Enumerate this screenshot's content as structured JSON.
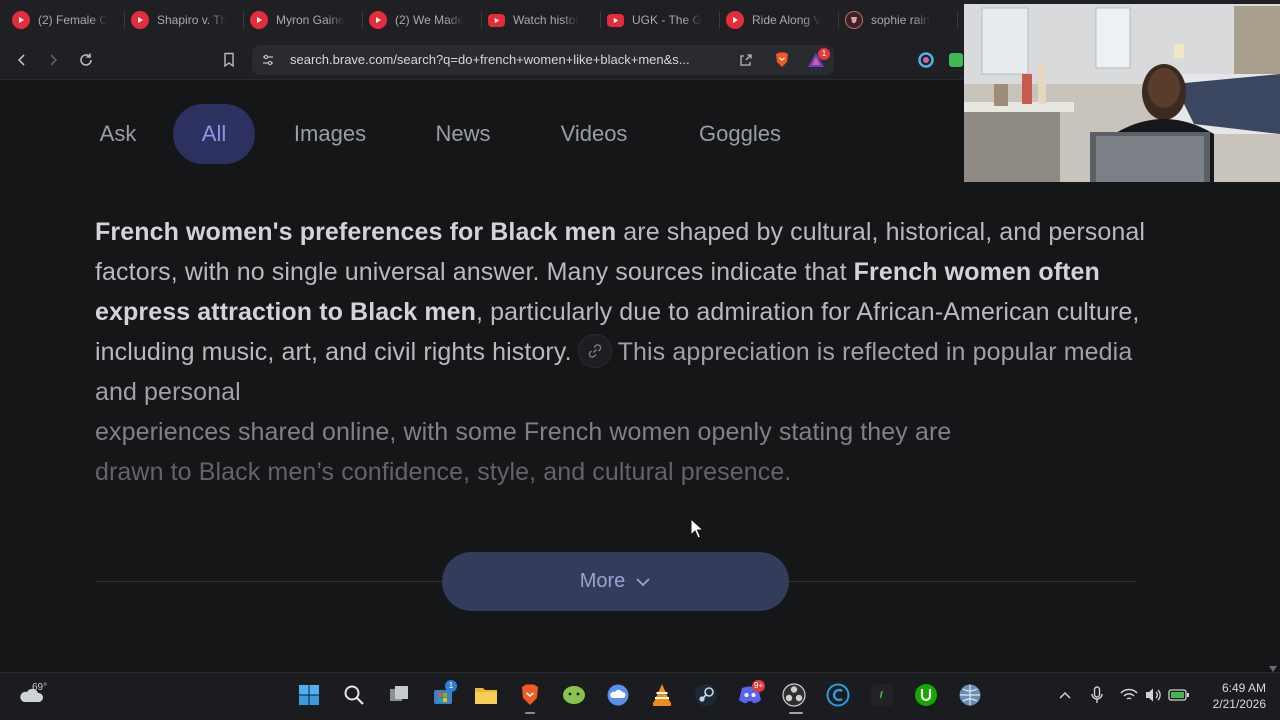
{
  "browser": {
    "tabs": [
      {
        "title": "(2) Female C",
        "icon": "youtube-circle-icon"
      },
      {
        "title": "Shapiro v. Th",
        "icon": "youtube-circle-icon"
      },
      {
        "title": "Myron Gaine",
        "icon": "youtube-circle-icon"
      },
      {
        "title": "(2) We Made",
        "icon": "youtube-circle-icon"
      },
      {
        "title": "Watch histor",
        "icon": "youtube-icon"
      },
      {
        "title": "UGK - The G",
        "icon": "youtube-icon"
      },
      {
        "title": "Ride Along V",
        "icon": "youtube-circle-icon"
      },
      {
        "title": "sophie rain",
        "icon": "brave-icon"
      }
    ],
    "url": "search.brave.com/search?q=do+french+women+like+black+men&s...",
    "rewards_badge": "1"
  },
  "search_nav": {
    "items": [
      "Ask",
      "All",
      "Images",
      "News",
      "Videos",
      "Goggles"
    ],
    "active": "All"
  },
  "answer": {
    "p1_bold": "French women's preferences for Black men",
    "p1_rest": " are shaped by cultural, historical, and personal factors, with no single universal answer. Many sources indicate that ",
    "p2_bold": "French women often express attraction to Black men",
    "p2_rest": ", particularly due to admiration for African-American culture, including music, art, and civil rights history.",
    "p3": "This appreciation is reflected in popular media and personal",
    "p4": "experiences shared online, with some French women openly stating they are",
    "p5": "drawn to Black men’s confidence, style, and cultural presence."
  },
  "more_button": {
    "label": "More"
  },
  "taskbar": {
    "weather": {
      "temp": "69°"
    },
    "apps": [
      "windows-start-icon",
      "search-icon",
      "task-view-icon",
      "microsoft-store-icon",
      "file-explorer-icon",
      "brave-icon",
      "android-icon",
      "cloud-app-icon",
      "vlc-icon",
      "steam-icon",
      "discord-icon",
      "obs-icon",
      "ccleaner-icon",
      "terminal-icon",
      "upwork-icon",
      "browser-globe-icon"
    ],
    "store_badge": "1",
    "discord_badge": "9+",
    "clock": {
      "time": "6:49 AM",
      "date": "2/21/2026"
    }
  }
}
